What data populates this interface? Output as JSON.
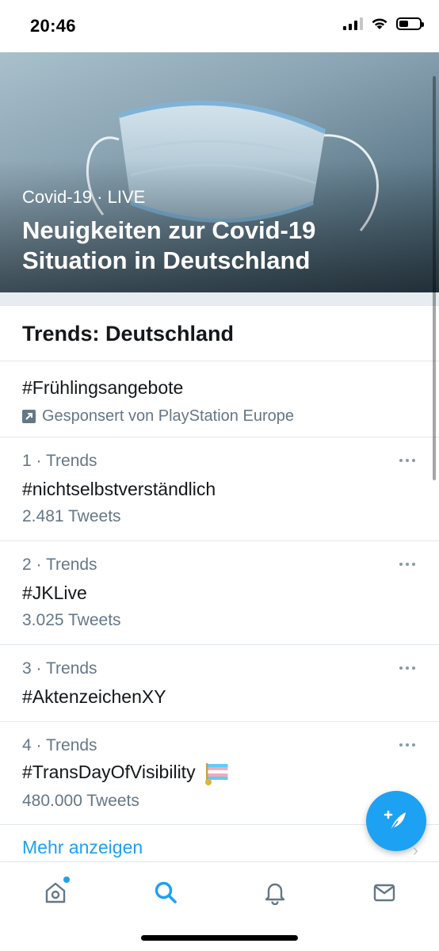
{
  "status_bar": {
    "time": "20:46"
  },
  "hero": {
    "category": "Covid-19",
    "separator": " · ",
    "live_label": "LIVE",
    "title": "Neuigkeiten zur Covid-19 Situation in Deutschland"
  },
  "trends": {
    "header": "Trends: Deutschland",
    "promoted": {
      "name": "#Frühlingsangebote",
      "sponsor": "Gesponsert von PlayStation Europe"
    },
    "items": [
      {
        "rank": "1",
        "meta": " · Trends",
        "name": "#nichtselbstverständlich",
        "count": "2.481 Tweets"
      },
      {
        "rank": "2",
        "meta": " · Trends",
        "name": "#JKLive",
        "count": "3.025 Tweets"
      },
      {
        "rank": "3",
        "meta": " · Trends",
        "name": "#AktenzeichenXY",
        "count": ""
      },
      {
        "rank": "4",
        "meta": " · Trends",
        "name": "#TransDayOfVisibility",
        "count": "480.000 Tweets"
      }
    ],
    "show_more": "Mehr anzeigen"
  },
  "tabbar": {
    "tabs": [
      "home-icon",
      "search-icon",
      "bell-icon",
      "mail-icon"
    ],
    "active": "search-icon"
  },
  "colors": {
    "accent": "#1da1f2",
    "text_secondary": "#657786",
    "divider": "#e1e8ed"
  }
}
